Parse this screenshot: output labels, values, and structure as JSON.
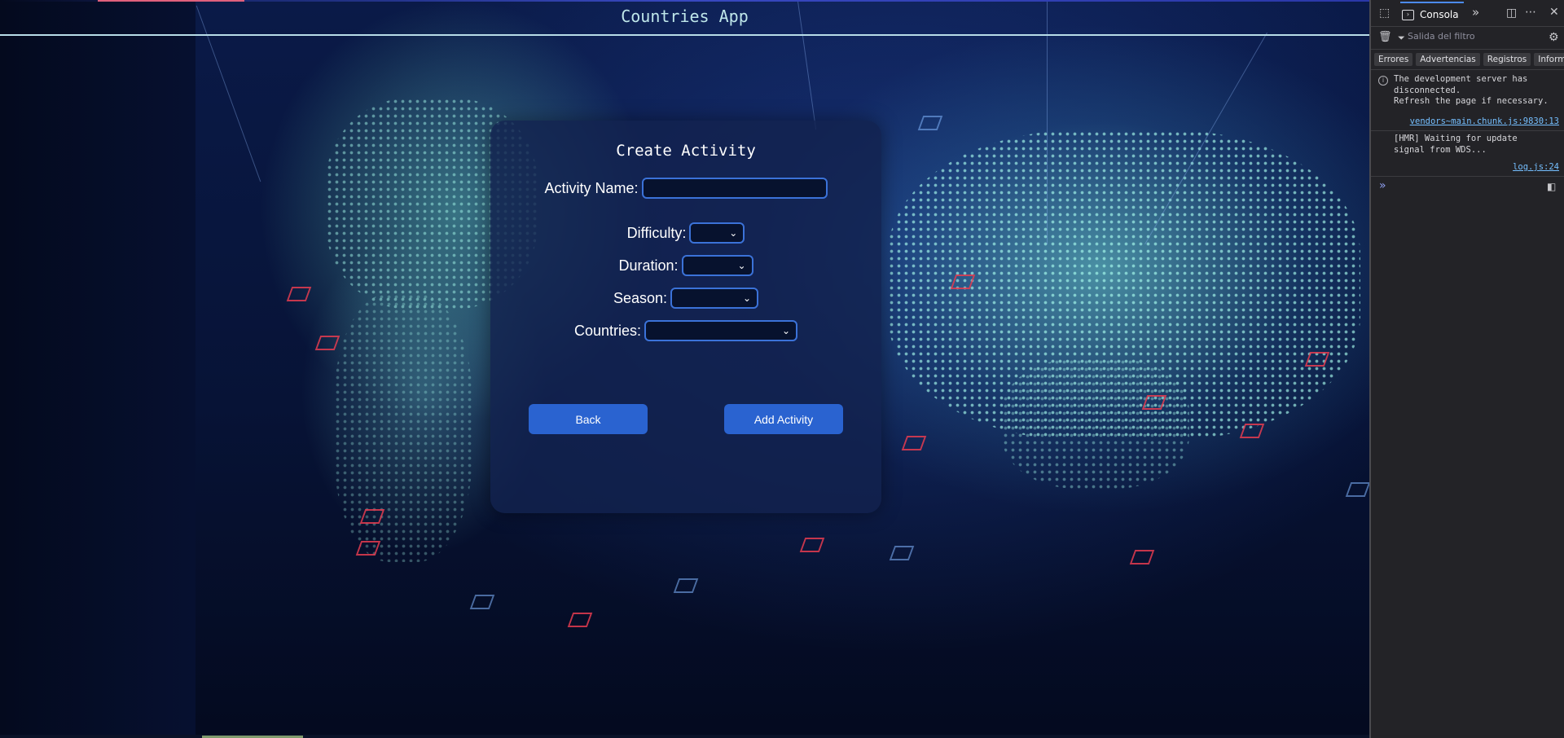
{
  "app": {
    "title": "Countries App"
  },
  "form": {
    "title": "Create Activity",
    "activity_name": {
      "label": "Activity Name:",
      "value": ""
    },
    "difficulty": {
      "label": "Difficulty:",
      "selected": ""
    },
    "duration": {
      "label": "Duration:",
      "selected": ""
    },
    "season": {
      "label": "Season:",
      "selected": ""
    },
    "countries": {
      "label": "Countries:",
      "selected": ""
    },
    "back_label": "Back",
    "submit_label": "Add Activity"
  },
  "devtools": {
    "active_tab": "Consola",
    "filter_placeholder": "Salida del filtro",
    "levels": [
      "Errores",
      "Advertencias",
      "Registros",
      "Información"
    ],
    "messages": [
      {
        "text": "The development server has\ndisconnected.\nRefresh the page if necessary.",
        "source": "vendors~main.chunk.js:9830:13",
        "icon": "info-icon"
      },
      {
        "text": "[HMR] Waiting for update\nsignal from WDS...",
        "source": "log.js:24",
        "icon": ""
      }
    ],
    "prompt_symbol": "»"
  },
  "colors": {
    "button_bg": "#2a63d0",
    "input_border": "#3b72d8",
    "header_line": "#b8dde8",
    "devtools_bg": "#232327",
    "devtools_link": "#75bfff"
  }
}
